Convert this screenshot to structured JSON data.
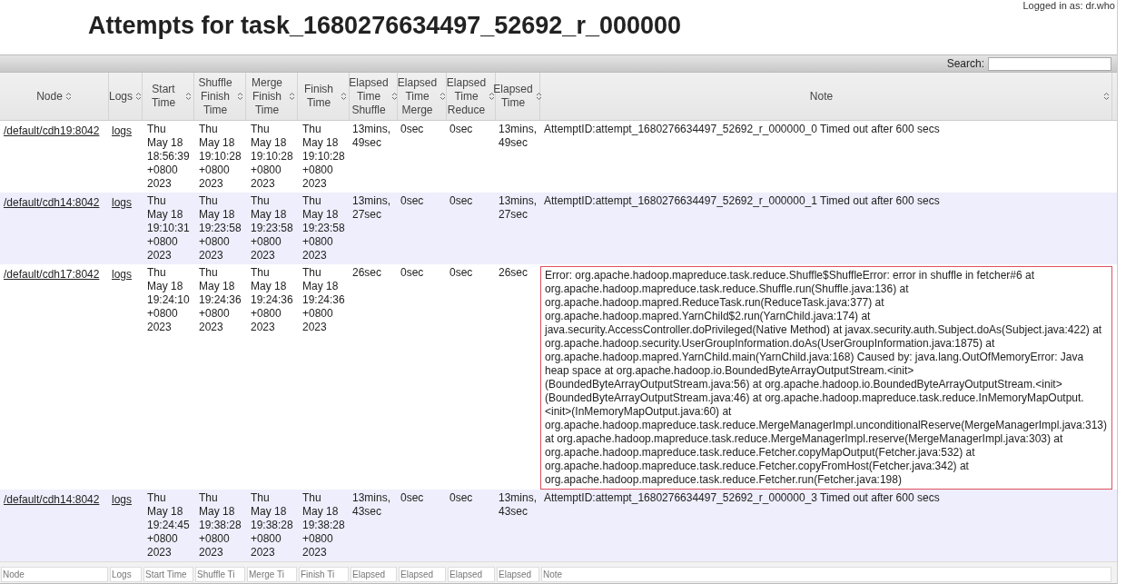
{
  "user": "Logged in as: dr.who",
  "title": "Attempts for task_1680276634497_52692_r_000000",
  "search": {
    "label": "Search:"
  },
  "columns": [
    {
      "label": "Node"
    },
    {
      "label": "Logs"
    },
    {
      "label": "Start Time"
    },
    {
      "label": "Shuffle Finish Time"
    },
    {
      "label": "Merge Finish Time"
    },
    {
      "label": "Finish Time"
    },
    {
      "label": "Elapsed Time Shuffle"
    },
    {
      "label": "Elapsed Time Merge"
    },
    {
      "label": "Elapsed Time Reduce"
    },
    {
      "label": "Elapsed Time"
    },
    {
      "label": "Note"
    }
  ],
  "rows": [
    {
      "node": "/default/cdh19:8042",
      "logs": "logs",
      "start": [
        "Thu",
        "May 18",
        "18:56:39",
        "+0800",
        "2023"
      ],
      "shuffle": [
        "Thu",
        "May 18",
        "19:10:28",
        "+0800",
        "2023"
      ],
      "merge": [
        "Thu",
        "May 18",
        "19:10:28",
        "+0800",
        "2023"
      ],
      "finish": [
        "Thu",
        "May 18",
        "19:10:28",
        "+0800",
        "2023"
      ],
      "el_shuffle": "13mins, 49sec",
      "el_merge": "0sec",
      "el_reduce": "0sec",
      "elapsed": "13mins, 49sec",
      "note": "AttemptID:attempt_1680276634497_52692_r_000000_0 Timed out after 600 secs",
      "highlighted": false
    },
    {
      "node": "/default/cdh14:8042",
      "logs": "logs",
      "start": [
        "Thu",
        "May 18",
        "19:10:31",
        "+0800",
        "2023"
      ],
      "shuffle": [
        "Thu",
        "May 18",
        "19:23:58",
        "+0800",
        "2023"
      ],
      "merge": [
        "Thu",
        "May 18",
        "19:23:58",
        "+0800",
        "2023"
      ],
      "finish": [
        "Thu",
        "May 18",
        "19:23:58",
        "+0800",
        "2023"
      ],
      "el_shuffle": "13mins, 27sec",
      "el_merge": "0sec",
      "el_reduce": "0sec",
      "elapsed": "13mins, 27sec",
      "note": "AttemptID:attempt_1680276634497_52692_r_000000_1 Timed out after 600 secs",
      "highlighted": false
    },
    {
      "node": "/default/cdh17:8042",
      "logs": "logs",
      "start": [
        "Thu",
        "May 18",
        "19:24:10",
        "+0800",
        "2023"
      ],
      "shuffle": [
        "Thu",
        "May 18",
        "19:24:36",
        "+0800",
        "2023"
      ],
      "merge": [
        "Thu",
        "May 18",
        "19:24:36",
        "+0800",
        "2023"
      ],
      "finish": [
        "Thu",
        "May 18",
        "19:24:36",
        "+0800",
        "2023"
      ],
      "el_shuffle": "26sec",
      "el_merge": "0sec",
      "el_reduce": "0sec",
      "elapsed": "26sec",
      "note": "Error: org.apache.hadoop.mapreduce.task.reduce.Shuffle$ShuffleError: error in shuffle in fetcher#6 at org.apache.hadoop.mapreduce.task.reduce.Shuffle.run(Shuffle.java:136) at org.apache.hadoop.mapred.ReduceTask.run(ReduceTask.java:377) at org.apache.hadoop.mapred.YarnChild$2.run(YarnChild.java:174) at java.security.AccessController.doPrivileged(Native Method) at javax.security.auth.Subject.doAs(Subject.java:422) at org.apache.hadoop.security.UserGroupInformation.doAs(UserGroupInformation.java:1875) at org.apache.hadoop.mapred.YarnChild.main(YarnChild.java:168) Caused by: java.lang.OutOfMemoryError: Java heap space at org.apache.hadoop.io.BoundedByteArrayOutputStream.<init>(BoundedByteArrayOutputStream.java:56) at org.apache.hadoop.io.BoundedByteArrayOutputStream.<init>(BoundedByteArrayOutputStream.java:46) at org.apache.hadoop.mapreduce.task.reduce.InMemoryMapOutput.<init>(InMemoryMapOutput.java:60) at org.apache.hadoop.mapreduce.task.reduce.MergeManagerImpl.unconditionalReserve(MergeManagerImpl.java:313) at org.apache.hadoop.mapreduce.task.reduce.MergeManagerImpl.reserve(MergeManagerImpl.java:303) at org.apache.hadoop.mapreduce.task.reduce.Fetcher.copyMapOutput(Fetcher.java:532) at org.apache.hadoop.mapreduce.task.reduce.Fetcher.copyFromHost(Fetcher.java:342) at org.apache.hadoop.mapreduce.task.reduce.Fetcher.run(Fetcher.java:198)",
      "highlighted": true
    },
    {
      "node": "/default/cdh14:8042",
      "logs": "logs",
      "start": [
        "Thu",
        "May 18",
        "19:24:45",
        "+0800",
        "2023"
      ],
      "shuffle": [
        "Thu",
        "May 18",
        "19:38:28",
        "+0800",
        "2023"
      ],
      "merge": [
        "Thu",
        "May 18",
        "19:38:28",
        "+0800",
        "2023"
      ],
      "finish": [
        "Thu",
        "May 18",
        "19:38:28",
        "+0800",
        "2023"
      ],
      "el_shuffle": "13mins, 43sec",
      "el_merge": "0sec",
      "el_reduce": "0sec",
      "elapsed": "13mins, 43sec",
      "note": "AttemptID:attempt_1680276634497_52692_r_000000_3 Timed out after 600 secs",
      "highlighted": false
    }
  ],
  "filters": [
    {
      "placeholder": "Node"
    },
    {
      "placeholder": "Logs"
    },
    {
      "placeholder": "Start Time"
    },
    {
      "placeholder": "Shuffle Ti"
    },
    {
      "placeholder": "Merge Ti"
    },
    {
      "placeholder": "Finish Ti"
    },
    {
      "placeholder": "Elapsed"
    },
    {
      "placeholder": "Elapsed"
    },
    {
      "placeholder": "Elapsed"
    },
    {
      "placeholder": "Elapsed"
    },
    {
      "placeholder": "Note"
    }
  ]
}
